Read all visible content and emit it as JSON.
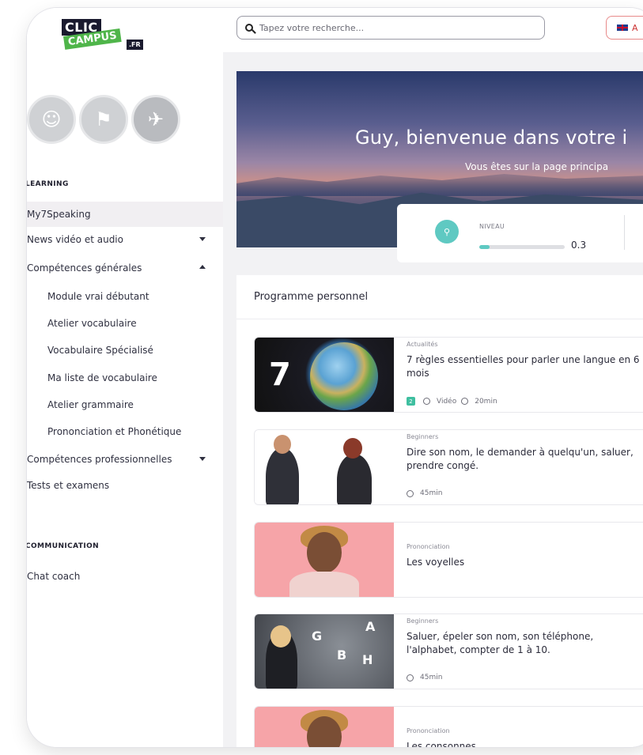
{
  "logo": {
    "line1": "CLIC",
    "line2": "CAMPUS",
    "suffix": ".FR"
  },
  "sidebar": {
    "sections": [
      {
        "title": "LEARNING"
      },
      {
        "title": "COMMUNICATION"
      }
    ],
    "items": [
      {
        "label": "My7Speaking"
      },
      {
        "label": "News vidéo et audio"
      },
      {
        "label": "Compétences générales"
      },
      {
        "label": "Module vrai débutant"
      },
      {
        "label": "Atelier vocabulaire"
      },
      {
        "label": "Vocabulaire Spécialisé"
      },
      {
        "label": "Ma liste de vocabulaire"
      },
      {
        "label": "Atelier grammaire"
      },
      {
        "label": "Prononciation et Phonétique"
      },
      {
        "label": "Compétences professionnelles"
      },
      {
        "label": "Tests et examens"
      },
      {
        "label": "Chat coach"
      }
    ]
  },
  "search": {
    "placeholder": "Tapez votre recherche..."
  },
  "language": {
    "label": "A"
  },
  "hero": {
    "greeting": "Guy, bienvenue dans votre i",
    "subtitle": "Vous êtes sur la page principa"
  },
  "stats": {
    "level_label": "NIVEAU",
    "level_value": "0.3",
    "progress": 0.12
  },
  "panel": {
    "title": "Programme personnel"
  },
  "cards": [
    {
      "category": "Actualités",
      "title": "7 règles essentielles pour parler une langue en 6 mois",
      "level": "2",
      "type": "Vidéo",
      "duration": "20min"
    },
    {
      "category": "Beginners",
      "title": "Dire son nom, le demander à quelqu'un, saluer, prendre congé.",
      "duration": "45min"
    },
    {
      "category": "Prononciation",
      "title": "Les voyelles"
    },
    {
      "category": "Beginners",
      "title": "Saluer, épeler son nom, son téléphone, l'alphabet, compter de 1 à 10.",
      "duration": "45min"
    },
    {
      "category": "Prononciation",
      "title": "Les consonnes"
    }
  ],
  "colors": {
    "accent": "#5fc9c2",
    "level_badge": "#3fbfa0",
    "card_pink": "#f6a4a8"
  }
}
